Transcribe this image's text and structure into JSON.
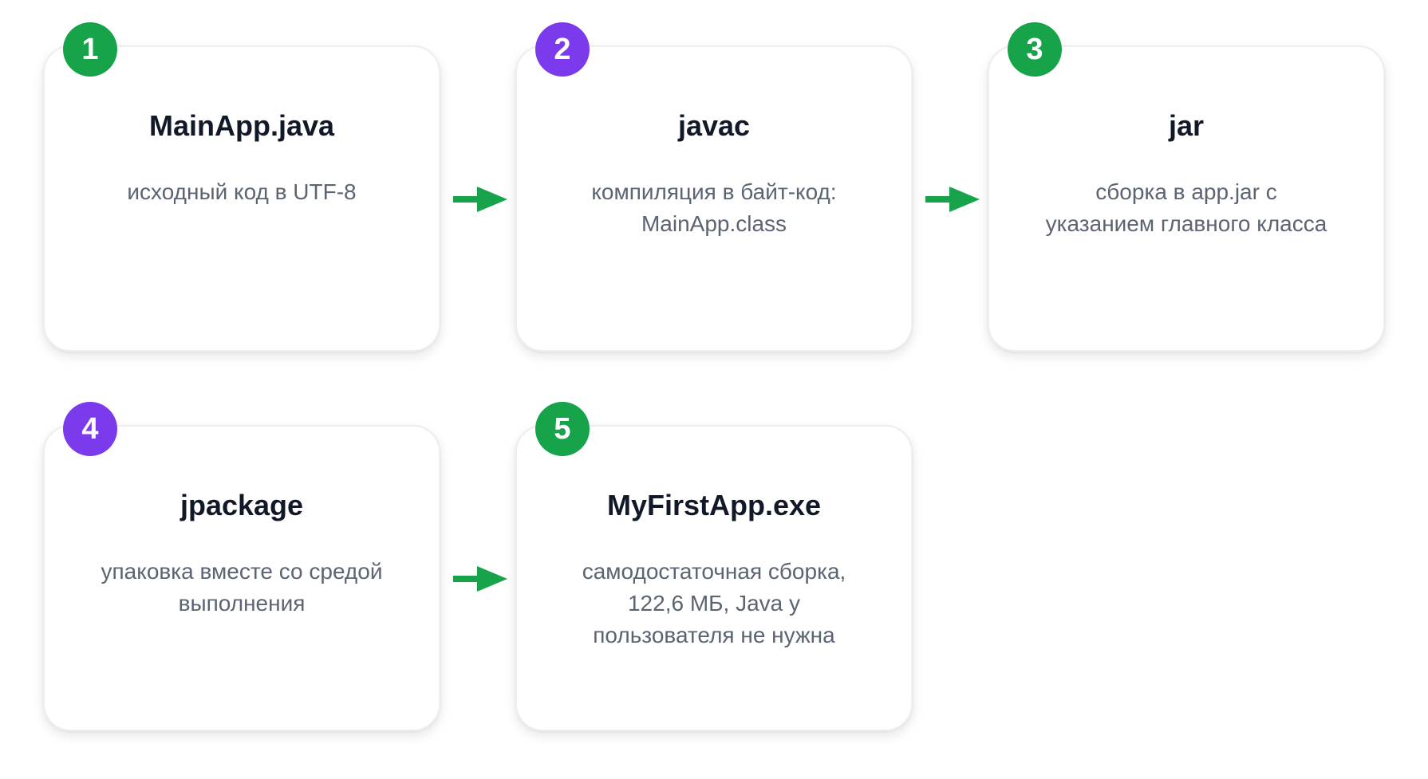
{
  "colors": {
    "green": "#16a34a",
    "purple": "#7c3aed",
    "card_border": "#eceef1",
    "title_text": "#111827",
    "desc_text": "#5b6472"
  },
  "steps": [
    {
      "number": "1",
      "badge_color": "green",
      "title": "MainApp.java",
      "description_lines": [
        "исходный код в UTF-8"
      ]
    },
    {
      "number": "2",
      "badge_color": "purple",
      "title": "javac",
      "description_lines": [
        "компиляция в байт-код:",
        "MainApp.class"
      ]
    },
    {
      "number": "3",
      "badge_color": "green",
      "title": "jar",
      "description_lines": [
        "сборка в app.jar с",
        "указанием главного класса"
      ]
    },
    {
      "number": "4",
      "badge_color": "purple",
      "title": "jpackage",
      "description_lines": [
        "упаковка вместе со средой",
        "выполнения"
      ]
    },
    {
      "number": "5",
      "badge_color": "green",
      "title": "MyFirstApp.exe",
      "description_lines": [
        "самодостаточная сборка,",
        "122,6 МБ, Java у",
        "пользователя не нужна"
      ]
    }
  ],
  "arrows": [
    {
      "from": "1",
      "to": "2",
      "icon": "right-arrow-icon",
      "color": "green"
    },
    {
      "from": "2",
      "to": "3",
      "icon": "right-arrow-icon",
      "color": "green"
    },
    {
      "from": "4",
      "to": "5",
      "icon": "right-arrow-icon",
      "color": "green"
    }
  ]
}
